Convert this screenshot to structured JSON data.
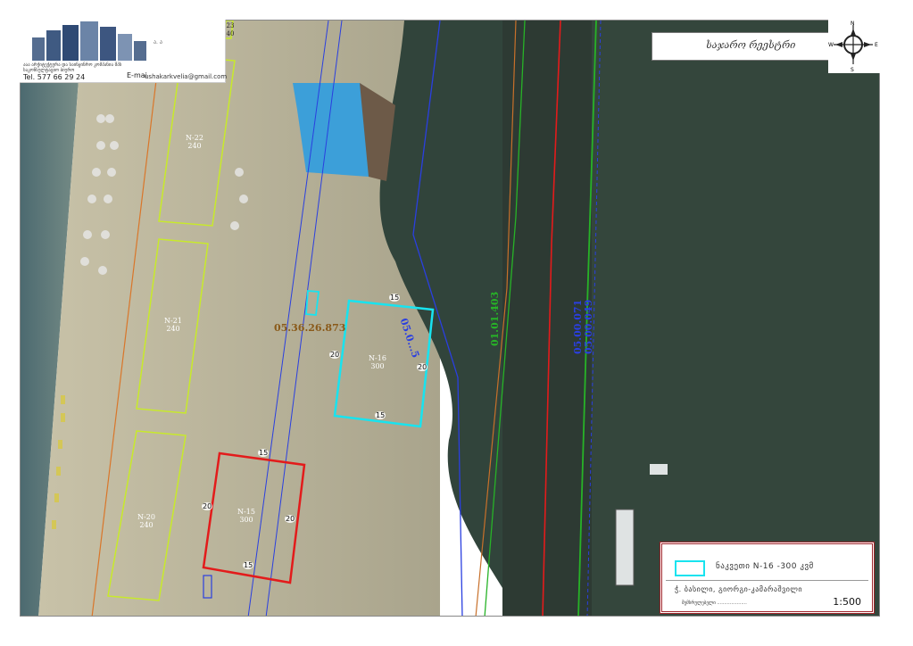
{
  "logo": {
    "tag": "ა. ა",
    "company": "ააა არქიტექტურა და საინჟინრო კომპანია შპს საკონსულტაციო ბიურო",
    "tel": "Tel.  577 66 29 24",
    "email_label": "E-mai",
    "email": "ushakarkvelia@gmail.com"
  },
  "title_signature": "საჯარო რეესტრი",
  "compass": {
    "n": "N",
    "s": "S",
    "e": "E",
    "w": "W"
  },
  "parcels": [
    {
      "id": "N-23",
      "label": "23",
      "area": "40"
    },
    {
      "id": "N-22",
      "label": "N-22",
      "area": "240"
    },
    {
      "id": "N-21",
      "label": "N-21",
      "area": "240"
    },
    {
      "id": "N-20",
      "label": "N-20",
      "area": "240"
    },
    {
      "id": "N-15",
      "label": "N-15",
      "area": "300"
    },
    {
      "id": "N-16",
      "label": "N-16",
      "area": "300"
    }
  ],
  "dimensions": {
    "width": "15",
    "height": "20"
  },
  "cadastral": {
    "main": "05.36.26.873",
    "c1": "05.0...5",
    "c2": "01.01.403",
    "c3": "05.00.071",
    "c4": "05.00.049"
  },
  "legend": {
    "item": "ნაკვეთი  N-16  -300  კვმ",
    "author": "ჭ. ბასილი,  გიორგი-კამარაშვილი",
    "sign": "შემსრულებელი .....................",
    "scale": "1:500"
  },
  "colors": {
    "selected_parcel": "#18e3ef",
    "existing_parcel": "#e31b1b",
    "plot_outline": "#c8ea2a",
    "cadastral_blue": "#2a3fe0",
    "cadastral_green": "#27b327",
    "legend_frame": "#a0262c"
  }
}
